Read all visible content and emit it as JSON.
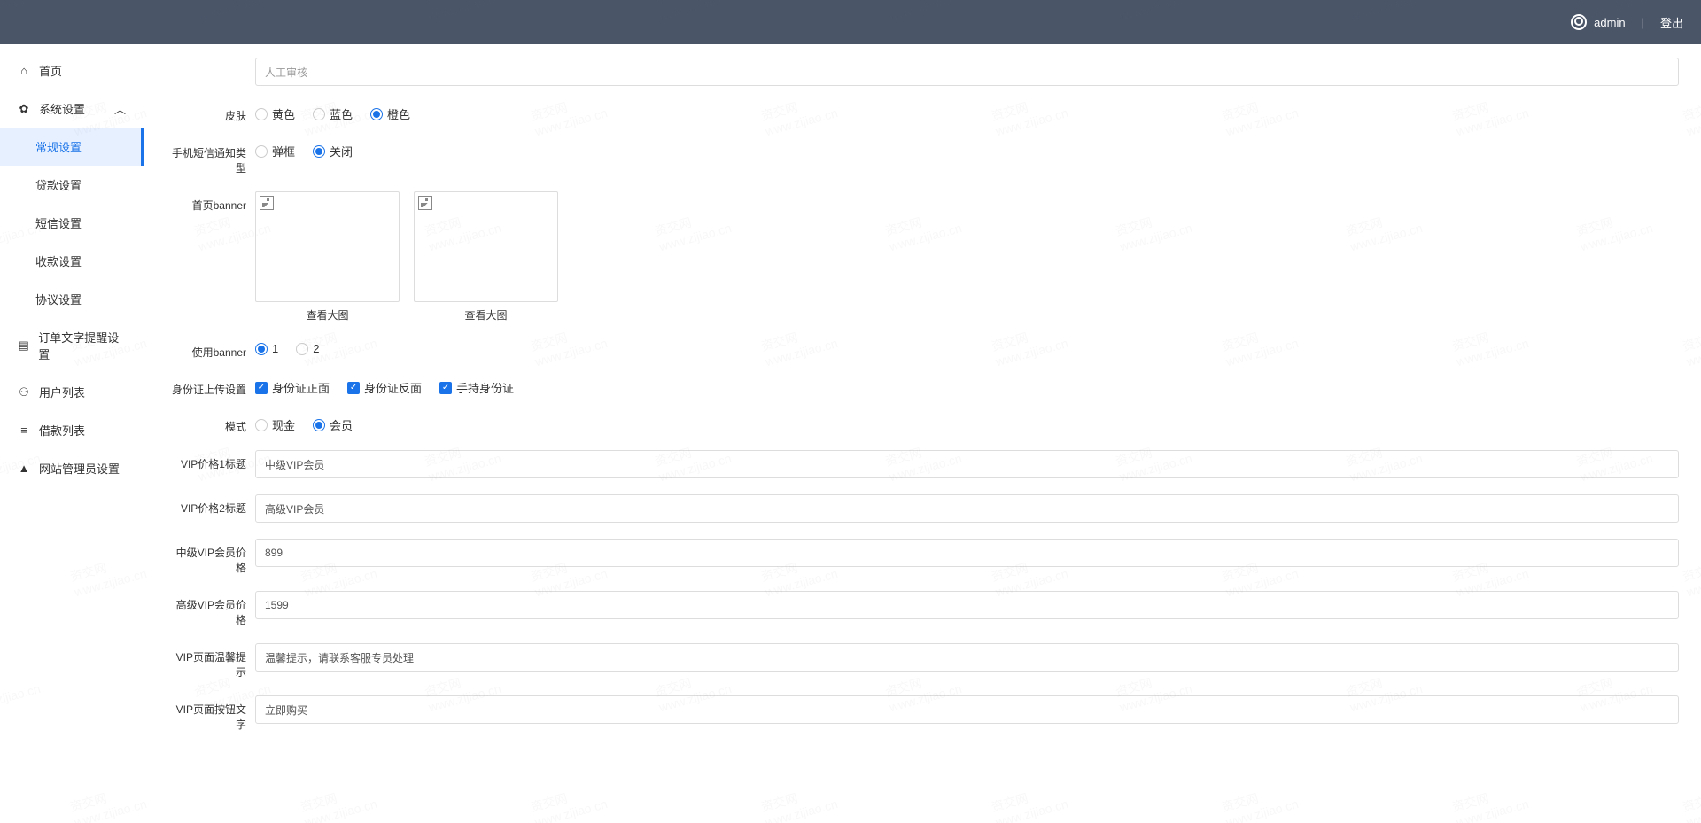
{
  "header": {
    "username": "admin",
    "logout": "登出",
    "separator": "|"
  },
  "sidebar": {
    "home": "首页",
    "system_settings": "系统设置",
    "sub_general": "常规设置",
    "sub_loan": "贷款设置",
    "sub_sms": "短信设置",
    "sub_payment": "收款设置",
    "sub_agreement": "协议设置",
    "order_reminder": "订单文字提醒设置",
    "user_list": "用户列表",
    "loan_list": "借款列表",
    "admin_settings": "网站管理员设置"
  },
  "form": {
    "select_label": "",
    "select_value": "人工审核",
    "skin_label": "皮肤",
    "skin_yellow": "黄色",
    "skin_blue": "蓝色",
    "skin_orange": "橙色",
    "sms_notify_label": "手机短信通知类型",
    "sms_popup": "弹框",
    "sms_close": "关闭",
    "banner_label": "首页banner",
    "banner_view": "查看大图",
    "use_banner_label": "使用banner",
    "use_banner_1": "1",
    "use_banner_2": "2",
    "id_upload_label": "身份证上传设置",
    "id_front": "身份证正面",
    "id_back": "身份证反面",
    "id_hand": "手持身份证",
    "mode_label": "模式",
    "mode_cash": "现金",
    "mode_member": "会员",
    "vip1_title_label": "VIP价格1标题",
    "vip1_title_value": "中级VIP会员",
    "vip2_title_label": "VIP价格2标题",
    "vip2_title_value": "高级VIP会员",
    "mid_vip_price_label": "中级VIP会员价格",
    "mid_vip_price_value": "899",
    "high_vip_price_label": "高级VIP会员价格",
    "high_vip_price_value": "1599",
    "vip_warm_tip_label": "VIP页面温馨提示",
    "vip_warm_tip_value": "温馨提示，请联系客服专员处理",
    "vip_button_label": "VIP页面按钮文字",
    "vip_button_value": "立即购买"
  },
  "watermark": {
    "text1": "资交网",
    "text2": "www.zijiao.cn"
  }
}
